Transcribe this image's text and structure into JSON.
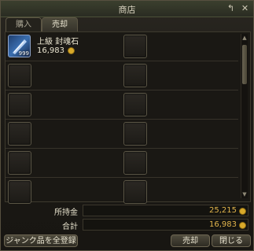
{
  "window": {
    "title": "商店"
  },
  "tabs": [
    {
      "label": "購入",
      "active": false
    },
    {
      "label": "売却",
      "active": true
    }
  ],
  "items": [
    {
      "name": "上級 封魂石",
      "price": "16,983",
      "quantity": "999",
      "icon": "soul-stone-icon"
    }
  ],
  "money": {
    "held_label": "所持金",
    "held_value": "25,215",
    "total_label": "合計",
    "total_value": "16,983"
  },
  "buttons": {
    "junk_all": "ジャンク品を全登録",
    "sell": "売却",
    "close": "閉じる"
  },
  "colors": {
    "accent_gold": "#e0b44c",
    "coin": "#d8a92a"
  }
}
